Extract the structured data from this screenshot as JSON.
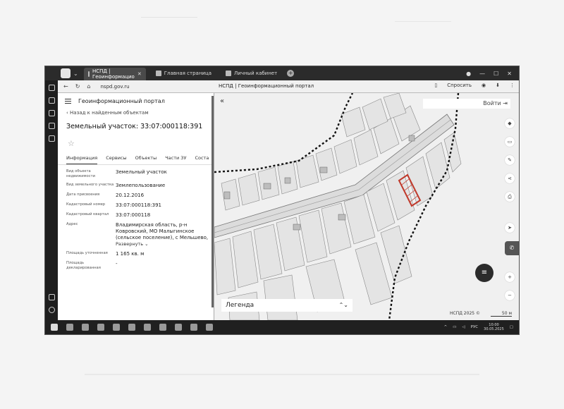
{
  "browser": {
    "tabs": [
      {
        "label": "НСПД | Геоинформацио",
        "active": true
      },
      {
        "label": "Главная страница",
        "active": false
      },
      {
        "label": "Личный кабинет",
        "active": false
      }
    ],
    "url": "nspd.gov.ru",
    "page_title": "НСПД | Геоинформационный портал",
    "ask_label": "Спросить"
  },
  "panel": {
    "header": "Геоинформационный портал",
    "back_label": "Назад к найденным объектам",
    "title": "Земельный участок: 33:07:000118:391",
    "tabs": [
      "Информация",
      "Сервисы",
      "Объекты",
      "Части ЗУ",
      "Соста"
    ],
    "rows": [
      {
        "key": "Вид объекта недвижимости",
        "value": "Земельный участок"
      },
      {
        "key": "Вид земельного участка",
        "value": "Землепользование"
      },
      {
        "key": "Дата присвоения",
        "value": "20.12.2016"
      },
      {
        "key": "Кадастровый номер",
        "value": "33:07:000118:391"
      },
      {
        "key": "Кадастровый квартал",
        "value": "33:07:000118"
      },
      {
        "key": "Адрес",
        "value": "Владимирская область, р-н Ковровский, МО Малыгинское (сельское поселение), с Мельшево,"
      },
      {
        "key": "Площадь уточненная",
        "value": "1 165 кв. м"
      },
      {
        "key": "Площадь декларированная",
        "value": "-"
      }
    ],
    "expand_label": "Развернуть"
  },
  "map": {
    "login_label": "Войти",
    "legend_label": "Легенда",
    "copyright": "НСПД 2025 ©",
    "scale_label": "50 м",
    "highlight_color": "#c0392b"
  },
  "taskbar": {
    "lang": "РУС",
    "time": "10:00",
    "date": "30.05.2025"
  }
}
